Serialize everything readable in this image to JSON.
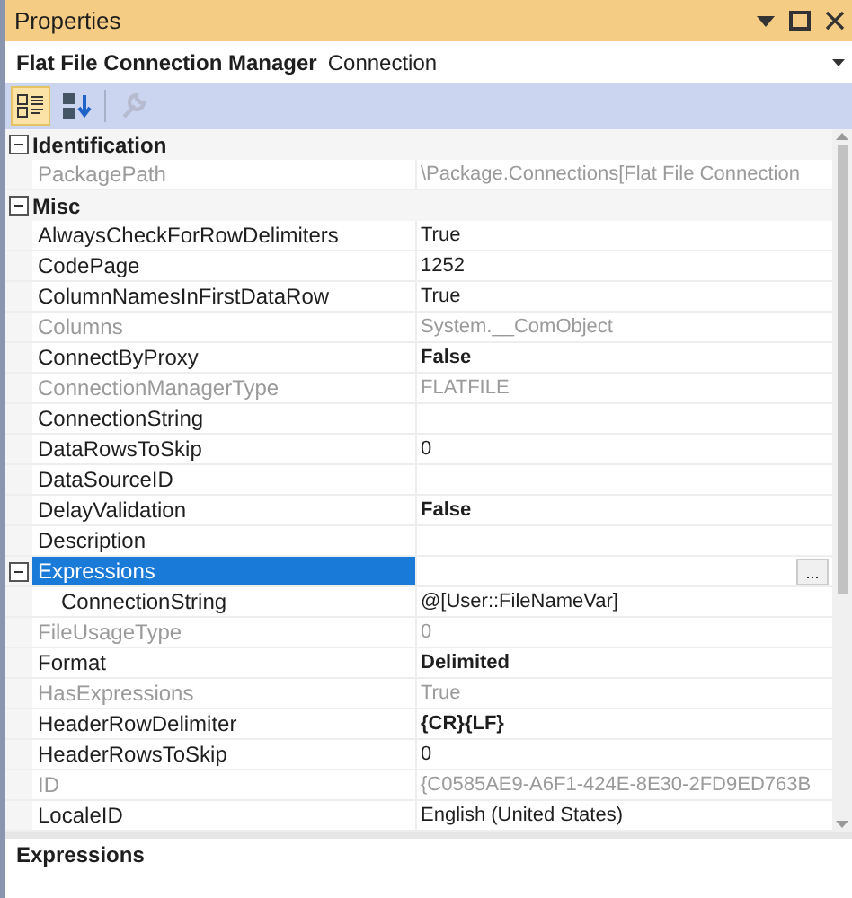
{
  "window": {
    "title": "Properties"
  },
  "object_selector": {
    "name": "Flat File Connection Manager",
    "type": "Connection"
  },
  "toolbar": [
    {
      "kind": "categorized",
      "selected": true
    },
    {
      "kind": "alphabetical",
      "selected": false
    },
    {
      "kind": "property-pages",
      "disabled": true
    }
  ],
  "grid": [
    {
      "kind": "category",
      "label": "Identification",
      "expanded": true,
      "children": [
        {
          "name": "PackagePath",
          "value": "\\Package.Connections[Flat File Connection",
          "readonly": true,
          "selected": false
        }
      ]
    },
    {
      "kind": "category",
      "label": "Misc",
      "expanded": true,
      "children": [
        {
          "name": "AlwaysCheckForRowDelimiters",
          "value": "True",
          "readonly": false,
          "modified": false,
          "selected": false
        },
        {
          "name": "CodePage",
          "value": "1252",
          "readonly": false,
          "modified": false,
          "selected": false
        },
        {
          "name": "ColumnNamesInFirstDataRow",
          "value": "True",
          "readonly": false,
          "modified": false,
          "selected": false
        },
        {
          "name": "Columns",
          "value": "System.__ComObject",
          "readonly": true,
          "selected": false
        },
        {
          "name": "ConnectByProxy",
          "value": "False",
          "readonly": false,
          "modified": true,
          "selected": false
        },
        {
          "name": "ConnectionManagerType",
          "value": "FLATFILE",
          "readonly": true,
          "selected": false
        },
        {
          "name": "ConnectionString",
          "readonly": false,
          "selected": false
        },
        {
          "name": "DataRowsToSkip",
          "value": "0",
          "readonly": false,
          "modified": false,
          "selected": false
        },
        {
          "name": "DataSourceID",
          "readonly": false,
          "selected": false
        },
        {
          "name": "DelayValidation",
          "value": "False",
          "readonly": false,
          "modified": true,
          "selected": false
        },
        {
          "name": "Description",
          "readonly": false,
          "selected": false
        },
        {
          "name": "Expressions",
          "readonly": false,
          "selected": true,
          "expanded": true,
          "editor_button": "...",
          "children": [
            {
              "name": "ConnectionString",
              "value": "@[User::FileNameVar]",
              "readonly": false,
              "modified": false,
              "selected": false
            }
          ]
        },
        {
          "name": "FileUsageType",
          "value": "0",
          "readonly": true,
          "selected": false
        },
        {
          "name": "Format",
          "value": "Delimited",
          "readonly": false,
          "modified": true,
          "selected": false
        },
        {
          "name": "HasExpressions",
          "value": "True",
          "readonly": true,
          "selected": false
        },
        {
          "name": "HeaderRowDelimiter",
          "value": "{CR}{LF}",
          "readonly": false,
          "modified": true,
          "selected": false
        },
        {
          "name": "HeaderRowsToSkip",
          "value": "0",
          "readonly": false,
          "modified": false,
          "selected": false
        },
        {
          "name": "ID",
          "value": "{C0585AE9-A6F1-424E-8E30-2FD9ED763B",
          "readonly": true,
          "selected": false
        },
        {
          "name": "LocaleID",
          "value": "English (United States)",
          "readonly": false,
          "modified": false,
          "selected": false
        }
      ]
    }
  ],
  "description": {
    "title": "Expressions"
  }
}
